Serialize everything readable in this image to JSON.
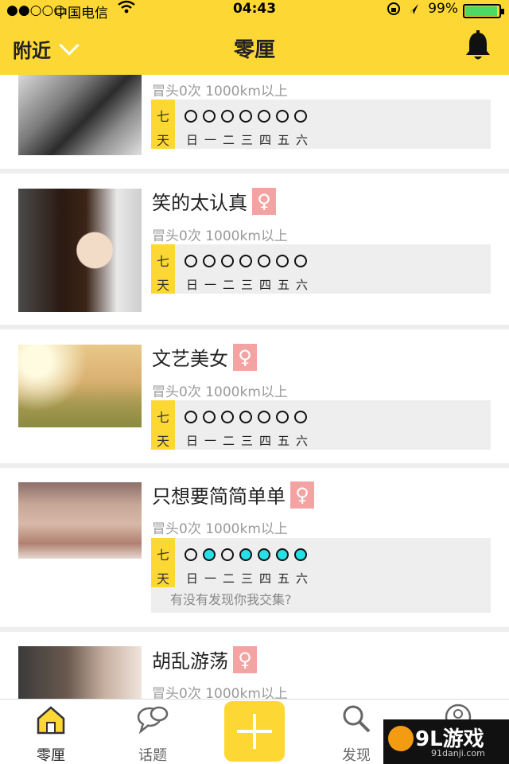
{
  "status_bar": {
    "signal": "●●○○○",
    "carrier": "中国电信",
    "time": "04:43",
    "battery": "99%",
    "battery_level": 0.99
  },
  "nav": {
    "location_label": "附近",
    "title": "零厘"
  },
  "day_tag": [
    "七",
    "天"
  ],
  "weekdays": [
    "日",
    "一",
    "二",
    "三",
    "四",
    "五",
    "六"
  ],
  "profiles": [
    {
      "name": "",
      "meta": "冒头0次 1000km以上",
      "sex_icon": "♀",
      "week": [
        0,
        0,
        0,
        0,
        0,
        0,
        0
      ],
      "note": ""
    },
    {
      "name": "笑的太认真",
      "meta": "冒头0次 1000km以上",
      "sex_icon": "♀",
      "week": [
        0,
        0,
        0,
        0,
        0,
        0,
        0
      ],
      "note": ""
    },
    {
      "name": "文艺美女",
      "meta": "冒头0次 1000km以上",
      "sex_icon": "♀",
      "week": [
        0,
        0,
        0,
        0,
        0,
        0,
        0
      ],
      "note": ""
    },
    {
      "name": "只想要简简单单",
      "meta": "冒头0次 1000km以上",
      "sex_icon": "♀",
      "week": [
        0,
        1,
        0,
        1,
        1,
        1,
        1
      ],
      "note": "有没有发现你我交集?"
    },
    {
      "name": "胡乱游荡",
      "meta": "冒头0次 1000km以上",
      "sex_icon": "♀",
      "week": [],
      "note": ""
    }
  ],
  "tabs": [
    {
      "label": "零厘",
      "icon": "home-icon"
    },
    {
      "label": "话题",
      "icon": "chat-icon"
    },
    {
      "label": "",
      "icon": "plus-icon"
    },
    {
      "label": "发现",
      "icon": "search-icon"
    },
    {
      "label": "",
      "icon": "profile-icon"
    }
  ],
  "watermark": {
    "big": "9L游戏",
    "small": "91danji.com"
  },
  "colors": {
    "accent": "#fdd835",
    "dot_active": "#26e0e8",
    "female_badge": "#f4a3a3"
  }
}
